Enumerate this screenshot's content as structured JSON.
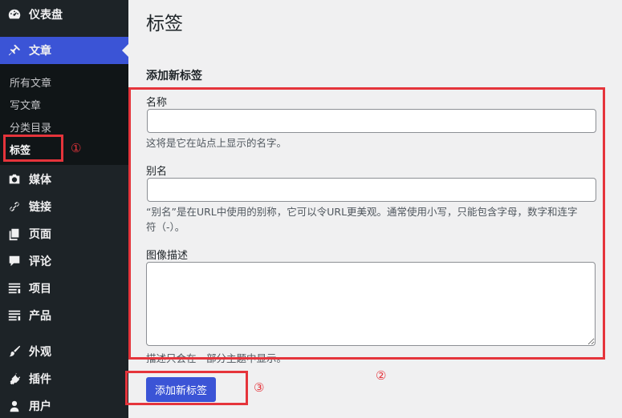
{
  "sidebar": {
    "dashboard": "仪表盘",
    "posts": "文章",
    "sub_items": [
      "所有文章",
      "写文章",
      "分类目录",
      "标签"
    ],
    "media": "媒体",
    "links": "链接",
    "pages": "页面",
    "comments": "评论",
    "projects": "项目",
    "products": "产品",
    "appearance": "外观",
    "plugins": "插件",
    "users": "用户"
  },
  "page": {
    "title": "标签",
    "section_title": "添加新标签",
    "name_label": "名称",
    "name_value": "",
    "name_help": "这将是它在站点上显示的名字。",
    "slug_label": "别名",
    "slug_value": "",
    "slug_help_line1": "“别名”是在URL中使用的别称，它可以令URL更美观。通常使用小写，只能包含字母，数字和连字",
    "slug_help_line2": "符（-）。",
    "desc_label": "图像描述",
    "desc_value": "",
    "desc_help": "描述只会在一部分主题中显示。",
    "submit": "添加新标签"
  },
  "annotations": [
    "①",
    "②",
    "③"
  ],
  "colors": {
    "sidebar_bg": "#1d2327",
    "accent": "#3b54d6",
    "annotation": "#e5343b"
  }
}
